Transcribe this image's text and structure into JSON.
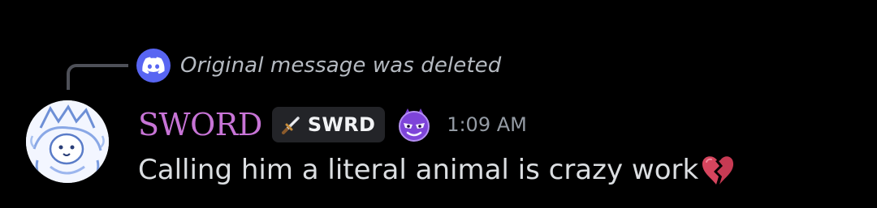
{
  "reply": {
    "icon": "discord-logo-icon",
    "text": "Original message was deleted"
  },
  "message": {
    "avatar_icon": "avatar-icon",
    "author": "SWORD",
    "author_color": "#c774d6",
    "tag": {
      "icon": "sword-icon",
      "label": "SWRD"
    },
    "role_icon": "purple-creature-role-icon",
    "timestamp": "1:09 AM",
    "content": "Calling him a literal animal is crazy work",
    "content_emoji": "broken-heart-icon"
  },
  "colors": {
    "background": "#000000",
    "blurple": "#5865f2",
    "muted_text": "#b5bac1",
    "message_text": "#dbdee1",
    "timestamp_text": "#949ba4"
  }
}
